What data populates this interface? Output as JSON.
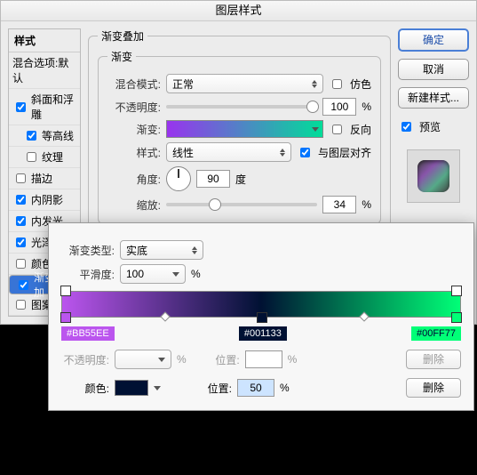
{
  "title": "图层样式",
  "styles_panel": {
    "title": "样式",
    "blend_options": "混合选项:默认",
    "items": [
      {
        "label": "斜面和浮雕",
        "checked": true
      },
      {
        "label": "等高线",
        "checked": true,
        "indent": true
      },
      {
        "label": "纹理",
        "checked": false,
        "indent": true
      },
      {
        "label": "描边",
        "checked": false
      },
      {
        "label": "内阴影",
        "checked": true
      },
      {
        "label": "内发光",
        "checked": true
      },
      {
        "label": "光泽",
        "checked": true
      },
      {
        "label": "颜色叠加",
        "checked": false
      },
      {
        "label": "渐变叠加",
        "checked": true,
        "selected": true
      },
      {
        "label": "图案叠加",
        "checked": false
      }
    ]
  },
  "gradient_overlay": {
    "section_title": "渐变叠加",
    "subsection": "渐变",
    "blend_mode_label": "混合模式:",
    "blend_mode_value": "正常",
    "dither_label": "仿色",
    "opacity_label": "不透明度:",
    "opacity_value": "100",
    "pct": "%",
    "gradient_label": "渐变:",
    "reverse_label": "反向",
    "style_label": "样式:",
    "style_value": "线性",
    "align_label": "与图层对齐",
    "angle_label": "角度:",
    "angle_value": "90",
    "angle_unit": "度",
    "scale_label": "缩放:",
    "scale_value": "34"
  },
  "buttons": {
    "ok": "确定",
    "cancel": "取消",
    "new_style": "新建样式...",
    "preview": "预览"
  },
  "editor": {
    "type_label": "渐变类型:",
    "type_value": "实底",
    "smooth_label": "平滑度:",
    "smooth_value": "100",
    "pct": "%",
    "stops": [
      "#BB55EE",
      "#001133",
      "#00FF77"
    ],
    "row1": {
      "opacity_label": "不透明度:",
      "pos_label": "位置:",
      "pct": "%",
      "delete": "删除"
    },
    "row2": {
      "color_label": "颜色:",
      "pos_label": "位置:",
      "pos_value": "50",
      "pct": "%",
      "delete": "删除"
    }
  },
  "chart_data": {
    "type": "gradient",
    "stops": [
      {
        "color": "#BB55EE",
        "position": 0
      },
      {
        "color": "#001133",
        "position": 50
      },
      {
        "color": "#00FF77",
        "position": 100
      }
    ],
    "opacity_stops": [
      {
        "opacity": 100,
        "position": 0
      },
      {
        "opacity": 100,
        "position": 100
      }
    ],
    "smoothness": 100
  }
}
